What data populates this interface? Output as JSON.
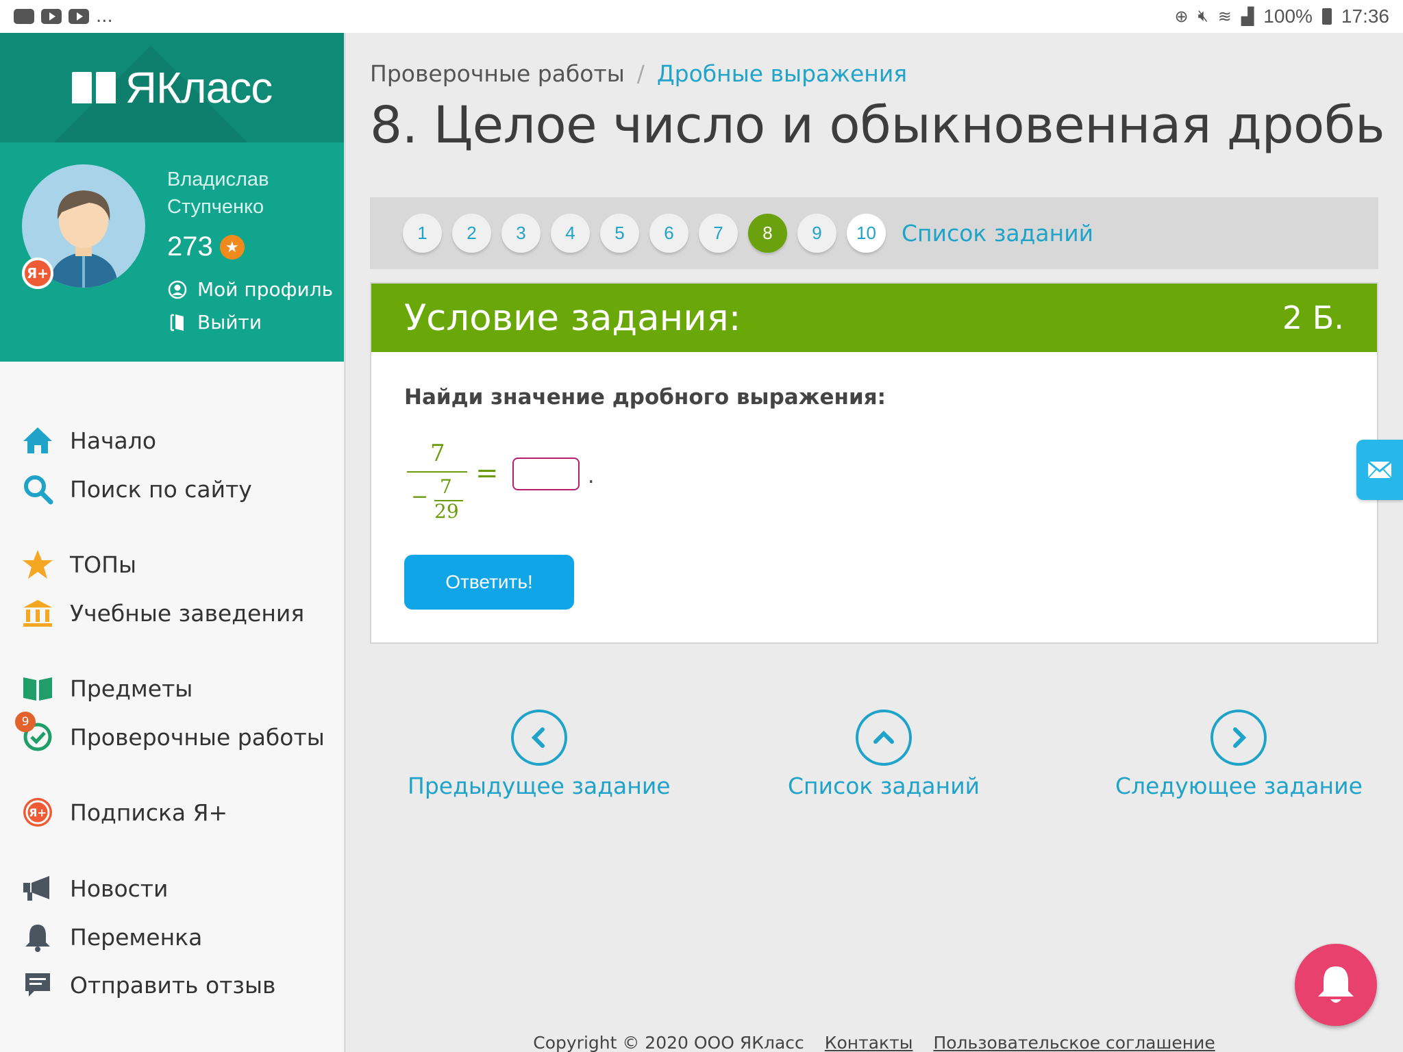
{
  "status_bar": {
    "left_more": "...",
    "battery": "100%",
    "time": "17:36"
  },
  "brand": {
    "logo_text": "ЯКласс"
  },
  "profile": {
    "first_name": "Владислав",
    "last_name": "Ступченко",
    "points": "273",
    "ya_badge": "Я+",
    "my_profile": "Мой профиль",
    "logout": "Выйти"
  },
  "nav": [
    {
      "label": "Начало",
      "icon": "home-icon",
      "color": "#1fa3c9"
    },
    {
      "label": "Поиск по сайту",
      "icon": "search-icon",
      "color": "#1fa3c9"
    },
    {
      "label": "ТОПы",
      "icon": "star-icon",
      "color": "#f5a623"
    },
    {
      "label": "Учебные заведения",
      "icon": "institution-icon",
      "color": "#f5a623"
    },
    {
      "label": "Предметы",
      "icon": "book-icon",
      "color": "#1f9e6a"
    },
    {
      "label": "Проверочные работы",
      "icon": "check-icon",
      "color": "#1f9e6a",
      "badge": "9"
    },
    {
      "label": "Подписка Я+",
      "icon": "ya-plus-icon",
      "color": "#ef5b35"
    },
    {
      "label": "Новости",
      "icon": "megaphone-icon",
      "color": "#4a5560"
    },
    {
      "label": "Переменка",
      "icon": "bell-icon",
      "color": "#4a5560"
    },
    {
      "label": "Отправить отзыв",
      "icon": "feedback-icon",
      "color": "#4a5560"
    }
  ],
  "breadcrumb": {
    "parent": "Проверочные работы",
    "separator": "/",
    "current": "Дробные выражения"
  },
  "page_title": "8. Целое число и обыкновенная дробь",
  "pager": {
    "pages": [
      "1",
      "2",
      "3",
      "4",
      "5",
      "6",
      "7",
      "8",
      "9",
      "10"
    ],
    "active": "8",
    "list_link": "Список заданий"
  },
  "task": {
    "header_title": "Условие задания:",
    "score": "2 Б.",
    "question": "Найди значение дробного выражения:",
    "numerator": "7",
    "minus": "−",
    "inner_numerator": "7",
    "inner_denominator": "29",
    "equals": "=",
    "dot": ".",
    "answer_value": "",
    "submit_label": "Ответить!",
    "accent_color": "#6aa80a",
    "button_color": "#10a5e6"
  },
  "bottom_nav": {
    "prev": "Предыдущее задание",
    "list": "Список заданий",
    "next": "Следующее задание"
  },
  "footer": {
    "copyright": "Copyright © 2020 ООО ЯКласс",
    "contacts": "Контакты",
    "agreement": "Пользовательское соглашение"
  }
}
